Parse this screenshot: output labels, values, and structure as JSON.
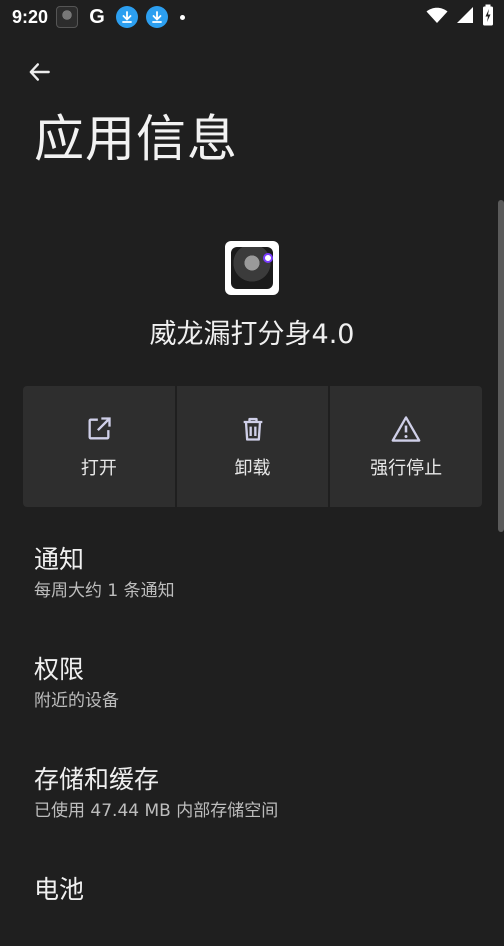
{
  "status_bar": {
    "time": "9:20",
    "icons": [
      "game-avatar-notification",
      "google-notification",
      "download-notification",
      "download-notification",
      "more-dot",
      "wifi",
      "signal",
      "battery-charging"
    ]
  },
  "toolbar": {
    "back_icon": "arrow-left-icon",
    "title": "应用信息"
  },
  "app": {
    "name": "威龙漏打分身4.0"
  },
  "actions": [
    {
      "label": "打开",
      "icon": "open-external-icon"
    },
    {
      "label": "卸载",
      "icon": "trash-icon"
    },
    {
      "label": "强行停止",
      "icon": "warning-icon"
    }
  ],
  "settings": [
    {
      "title": "通知",
      "summary": "每周大约 1 条通知"
    },
    {
      "title": "权限",
      "summary": "附近的设备"
    },
    {
      "title": "存储和缓存",
      "summary": "已使用 47.44 MB 内部存储空间"
    },
    {
      "title": "电池",
      "summary": ""
    }
  ],
  "colors": {
    "background": "#1f1f1f",
    "button_background": "#2e2e2e",
    "download_badge": "#2c9ff0",
    "text_primary": "#f0f0f0",
    "text_secondary": "#bdbdbd"
  }
}
